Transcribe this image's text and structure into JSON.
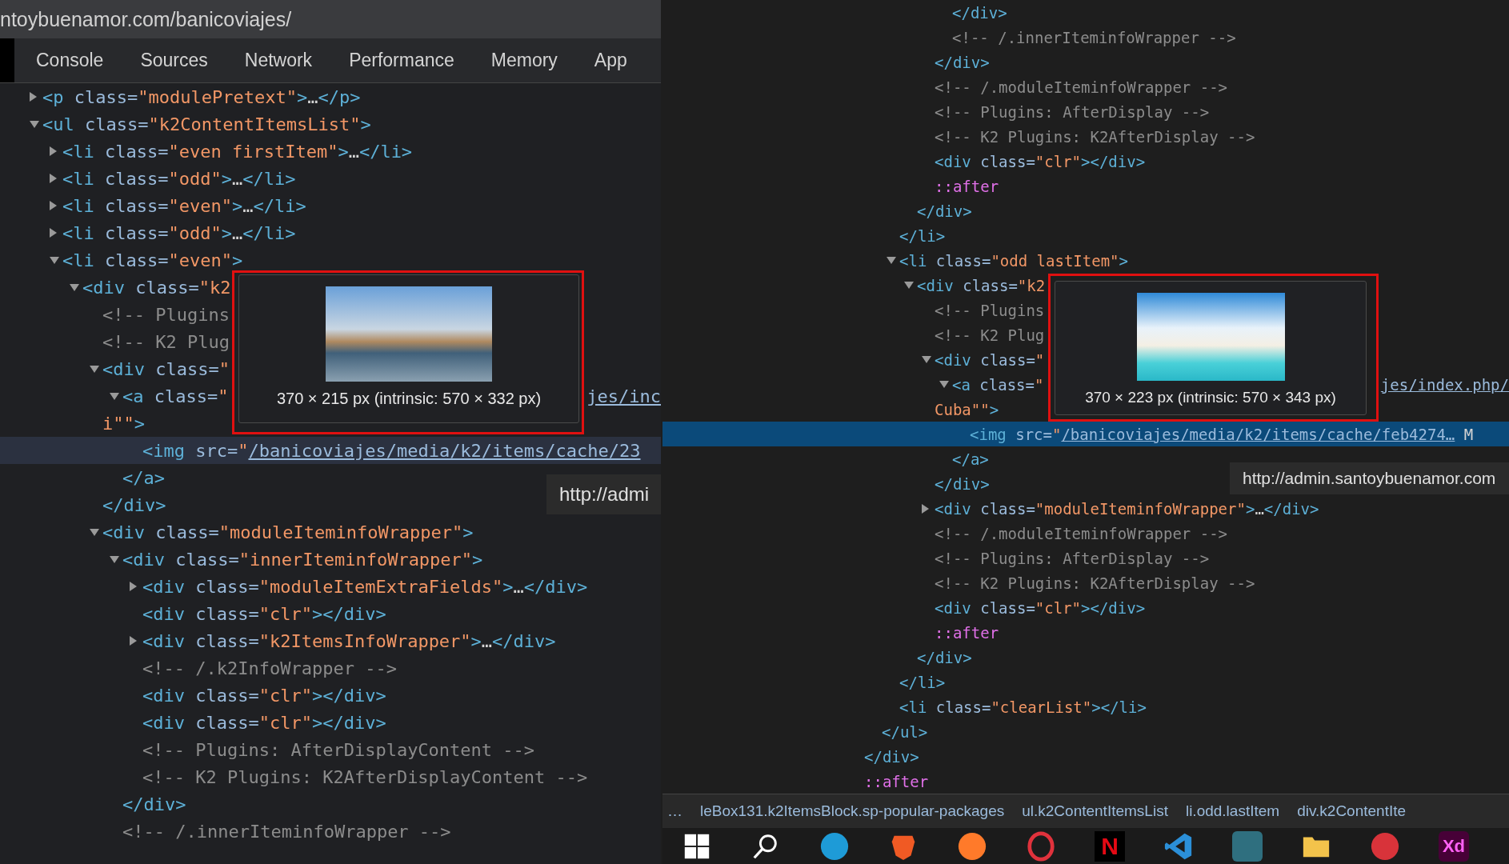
{
  "panels": [
    {
      "focused": false,
      "url": "ntoybuenamor.com/banicoviajes/",
      "tabs": [
        {
          "label": "Console",
          "selected": false
        },
        {
          "label": "Sources",
          "selected": false
        },
        {
          "label": "Network",
          "selected": false
        },
        {
          "label": "Performance",
          "selected": false
        },
        {
          "label": "Memory",
          "selected": false
        },
        {
          "label": "App",
          "selected": false
        }
      ],
      "lines": [
        {
          "code": [
            {
              "kind": "tag",
              "text": "<p"
            },
            {
              "kind": "attr",
              "text": " class="
            },
            {
              "kind": "value",
              "text": "\"modulePretext\""
            },
            {
              "kind": "tag",
              "text": ">"
            },
            {
              "kind": "text",
              "text": "…"
            },
            {
              "kind": "tag",
              "text": "</p>"
            }
          ],
          "expanded": false,
          "selected": false
        },
        {
          "code": [
            {
              "kind": "tag",
              "text": "<ul"
            },
            {
              "kind": "attr",
              "text": " class="
            },
            {
              "kind": "value",
              "text": "\"k2ContentItemsList\""
            },
            {
              "kind": "tag",
              "text": ">"
            }
          ],
          "expanded": true,
          "selected": false,
          "children": [
            {
              "code": [
                {
                  "kind": "tag",
                  "text": "<li"
                },
                {
                  "kind": "attr",
                  "text": " class="
                },
                {
                  "kind": "value",
                  "text": "\"even firstItem\""
                },
                {
                  "kind": "tag",
                  "text": ">"
                },
                {
                  "kind": "text",
                  "text": "…"
                },
                {
                  "kind": "tag",
                  "text": "</li>"
                }
              ],
              "expanded": false,
              "selected": false
            },
            {
              "code": [
                {
                  "kind": "tag",
                  "text": "<li"
                },
                {
                  "kind": "attr",
                  "text": " class="
                },
                {
                  "kind": "value",
                  "text": "\"odd\""
                },
                {
                  "kind": "tag",
                  "text": ">"
                },
                {
                  "kind": "text",
                  "text": "…"
                },
                {
                  "kind": "tag",
                  "text": "</li>"
                }
              ],
              "expanded": false,
              "selected": false
            },
            {
              "code": [
                {
                  "kind": "tag",
                  "text": "<li"
                },
                {
                  "kind": "attr",
                  "text": " class="
                },
                {
                  "kind": "value",
                  "text": "\"even\""
                },
                {
                  "kind": "tag",
                  "text": ">"
                },
                {
                  "kind": "text",
                  "text": "…"
                },
                {
                  "kind": "tag",
                  "text": "</li>"
                }
              ],
              "expanded": false,
              "selected": false
            },
            {
              "code": [
                {
                  "kind": "tag",
                  "text": "<li"
                },
                {
                  "kind": "attr",
                  "text": " class="
                },
                {
                  "kind": "value",
                  "text": "\"odd\""
                },
                {
                  "kind": "tag",
                  "text": ">"
                },
                {
                  "kind": "text",
                  "text": "…"
                },
                {
                  "kind": "tag",
                  "text": "</li>"
                }
              ],
              "expanded": false,
              "selected": false
            },
            {
              "code": [
                {
                  "kind": "tag",
                  "text": "<li"
                },
                {
                  "kind": "attr",
                  "text": " class="
                },
                {
                  "kind": "value",
                  "text": "\"even\""
                },
                {
                  "kind": "tag",
                  "text": ">"
                }
              ],
              "expanded": true,
              "selected": false,
              "children": [
                {
                  "code": [
                    {
                      "kind": "tag",
                      "text": "<div"
                    },
                    {
                      "kind": "attr",
                      "text": " class="
                    },
                    {
                      "kind": "value",
                      "text": "\"k2"
                    }
                  ],
                  "expanded": true,
                  "selected": false,
                  "children": [
                    {
                      "code": [
                        {
                          "kind": "comment",
                          "text": "<!-- Plugins"
                        }
                      ],
                      "selected": false
                    },
                    {
                      "code": [
                        {
                          "kind": "comment",
                          "text": "<!-- K2 Plug"
                        }
                      ],
                      "selected": false
                    },
                    {
                      "code": [
                        {
                          "kind": "tag",
                          "text": "<div"
                        },
                        {
                          "kind": "attr",
                          "text": " class="
                        },
                        {
                          "kind": "value",
                          "text": "\""
                        }
                      ],
                      "expanded": true,
                      "selected": false,
                      "children": [
                        {
                          "code": [
                            {
                              "kind": "tag",
                              "text": "<a"
                            },
                            {
                              "kind": "attr",
                              "text": " class="
                            },
                            {
                              "kind": "value",
                              "text": "\""
                            }
                          ],
                          "tail": [
                            {
                              "kind": "link",
                              "text": "jes/inc"
                            }
                          ],
                          "wrap": [
                            {
                              "kind": "value",
                              "text": "i\"\""
                            },
                            {
                              "kind": "tag",
                              "text": ">"
                            }
                          ],
                          "expanded": true,
                          "selected": false,
                          "children": [
                            {
                              "code": [
                                {
                                  "kind": "tag",
                                  "text": "<img"
                                },
                                {
                                  "kind": "attr",
                                  "text": " src="
                                },
                                {
                                  "kind": "value",
                                  "text": "\""
                                },
                                {
                                  "kind": "link",
                                  "text": "/banicoviajes/media/k2/items/cache/23"
                                }
                              ],
                              "selected": true
                            }
                          ]
                        },
                        {
                          "code": [
                            {
                              "kind": "tag",
                              "text": "</a>"
                            }
                          ],
                          "selected": false
                        }
                      ]
                    },
                    {
                      "code": [
                        {
                          "kind": "tag",
                          "text": "</div>"
                        }
                      ],
                      "selected": false
                    },
                    {
                      "code": [
                        {
                          "kind": "tag",
                          "text": "<div"
                        },
                        {
                          "kind": "attr",
                          "text": " class="
                        },
                        {
                          "kind": "value",
                          "text": "\"moduleIteminfoWrapper\""
                        },
                        {
                          "kind": "tag",
                          "text": ">"
                        }
                      ],
                      "expanded": true,
                      "selected": false,
                      "children": [
                        {
                          "code": [
                            {
                              "kind": "tag",
                              "text": "<div"
                            },
                            {
                              "kind": "attr",
                              "text": " class="
                            },
                            {
                              "kind": "value",
                              "text": "\"innerIteminfoWrapper\""
                            },
                            {
                              "kind": "tag",
                              "text": ">"
                            }
                          ],
                          "expanded": true,
                          "selected": false,
                          "children": [
                            {
                              "code": [
                                {
                                  "kind": "tag",
                                  "text": "<div"
                                },
                                {
                                  "kind": "attr",
                                  "text": " class="
                                },
                                {
                                  "kind": "value",
                                  "text": "\"moduleItemExtraFields\""
                                },
                                {
                                  "kind": "tag",
                                  "text": ">"
                                },
                                {
                                  "kind": "text",
                                  "text": "…"
                                },
                                {
                                  "kind": "tag",
                                  "text": "</div>"
                                }
                              ],
                              "expanded": false,
                              "selected": false
                            },
                            {
                              "code": [
                                {
                                  "kind": "tag",
                                  "text": "<div"
                                },
                                {
                                  "kind": "attr",
                                  "text": " class="
                                },
                                {
                                  "kind": "value",
                                  "text": "\"clr\""
                                },
                                {
                                  "kind": "tag",
                                  "text": "></div>"
                                }
                              ],
                              "selected": false
                            },
                            {
                              "code": [
                                {
                                  "kind": "tag",
                                  "text": "<div"
                                },
                                {
                                  "kind": "attr",
                                  "text": " class="
                                },
                                {
                                  "kind": "value",
                                  "text": "\"k2ItemsInfoWrapper\""
                                },
                                {
                                  "kind": "tag",
                                  "text": ">"
                                },
                                {
                                  "kind": "text",
                                  "text": "…"
                                },
                                {
                                  "kind": "tag",
                                  "text": "</div>"
                                }
                              ],
                              "expanded": false,
                              "selected": false
                            },
                            {
                              "code": [
                                {
                                  "kind": "comment",
                                  "text": "<!-- /.k2InfoWrapper -->"
                                }
                              ],
                              "selected": false
                            },
                            {
                              "code": [
                                {
                                  "kind": "tag",
                                  "text": "<div"
                                },
                                {
                                  "kind": "attr",
                                  "text": " class="
                                },
                                {
                                  "kind": "value",
                                  "text": "\"clr\""
                                },
                                {
                                  "kind": "tag",
                                  "text": "></div>"
                                }
                              ],
                              "selected": false
                            },
                            {
                              "code": [
                                {
                                  "kind": "tag",
                                  "text": "<div"
                                },
                                {
                                  "kind": "attr",
                                  "text": " class="
                                },
                                {
                                  "kind": "value",
                                  "text": "\"clr\""
                                },
                                {
                                  "kind": "tag",
                                  "text": "></div>"
                                }
                              ],
                              "selected": false
                            },
                            {
                              "code": [
                                {
                                  "kind": "comment",
                                  "text": "<!-- Plugins: AfterDisplayContent -->"
                                }
                              ],
                              "selected": false
                            },
                            {
                              "code": [
                                {
                                  "kind": "comment",
                                  "text": "<!-- K2 Plugins: K2AfterDisplayContent -->"
                                }
                              ],
                              "selected": false
                            }
                          ]
                        },
                        {
                          "code": [
                            {
                              "kind": "tag",
                              "text": "</div>"
                            }
                          ],
                          "selected": false
                        },
                        {
                          "code": [
                            {
                              "kind": "comment",
                              "text": "<!-- /.innerIteminfoWrapper -->"
                            }
                          ],
                          "selected": false
                        }
                      ]
                    }
                  ]
                }
              ]
            }
          ]
        }
      ],
      "image_tooltip": "370 × 215 px (intrinsic: 570 × 332 px)",
      "link_tooltip": "http://admi"
    },
    {
      "focused": true,
      "lines": [
        {
          "children": [
            {
              "children": [
                {
                  "children": [
                    {
                      "children": [
                        {
                          "children": [
                            {
                              "code": [
                                {
                                  "kind": "tag",
                                  "text": "</div>"
                                }
                              ],
                              "selected": false
                            },
                            {
                              "code": [
                                {
                                  "kind": "comment",
                                  "text": "<!-- /.innerIteminfoWrapper -->"
                                }
                              ],
                              "selected": false
                            }
                          ]
                        },
                        {
                          "code": [
                            {
                              "kind": "tag",
                              "text": "</div>"
                            }
                          ],
                          "selected": false
                        },
                        {
                          "code": [
                            {
                              "kind": "comment",
                              "text": "<!-- /.moduleIteminfoWrapper -->"
                            }
                          ],
                          "selected": false
                        },
                        {
                          "code": [
                            {
                              "kind": "comment",
                              "text": "<!-- Plugins: AfterDisplay -->"
                            }
                          ],
                          "selected": false
                        },
                        {
                          "code": [
                            {
                              "kind": "comment",
                              "text": "<!-- K2 Plugins: K2AfterDisplay -->"
                            }
                          ],
                          "selected": false
                        },
                        {
                          "code": [
                            {
                              "kind": "tag",
                              "text": "<div"
                            },
                            {
                              "kind": "attr",
                              "text": " class="
                            },
                            {
                              "kind": "value",
                              "text": "\"clr\""
                            },
                            {
                              "kind": "tag",
                              "text": "></div>"
                            }
                          ],
                          "selected": false
                        },
                        {
                          "code": [
                            {
                              "kind": "pseudo",
                              "text": "::after"
                            }
                          ],
                          "selected": false
                        }
                      ]
                    },
                    {
                      "code": [
                        {
                          "kind": "tag",
                          "text": "</div>"
                        }
                      ],
                      "selected": false
                    }
                  ]
                },
                {
                  "code": [
                    {
                      "kind": "tag",
                      "text": "</li>"
                    }
                  ],
                  "selected": false
                },
                {
                  "code": [
                    {
                      "kind": "tag",
                      "text": "<li"
                    },
                    {
                      "kind": "attr",
                      "text": " class="
                    },
                    {
                      "kind": "value",
                      "text": "\"odd lastItem\""
                    },
                    {
                      "kind": "tag",
                      "text": ">"
                    }
                  ],
                  "expanded": true,
                  "selected": false,
                  "children": [
                    {
                      "code": [
                        {
                          "kind": "tag",
                          "text": "<div"
                        },
                        {
                          "kind": "attr",
                          "text": " class="
                        },
                        {
                          "kind": "value",
                          "text": "\"k2"
                        }
                      ],
                      "expanded": true,
                      "selected": false,
                      "children": [
                        {
                          "code": [
                            {
                              "kind": "comment",
                              "text": "<!-- Plugins"
                            }
                          ],
                          "selected": false
                        },
                        {
                          "code": [
                            {
                              "kind": "comment",
                              "text": "<!-- K2 Plug"
                            }
                          ],
                          "selected": false
                        },
                        {
                          "code": [
                            {
                              "kind": "tag",
                              "text": "<div"
                            },
                            {
                              "kind": "attr",
                              "text": " class="
                            },
                            {
                              "kind": "value",
                              "text": "\""
                            }
                          ],
                          "expanded": true,
                          "selected": false,
                          "children": [
                            {
                              "code": [
                                {
                                  "kind": "tag",
                                  "text": "<a"
                                },
                                {
                                  "kind": "attr",
                                  "text": " class="
                                },
                                {
                                  "kind": "value",
                                  "text": "\""
                                }
                              ],
                              "tail": [
                                {
                                  "kind": "link",
                                  "text": "jes/index.php/"
                                }
                              ],
                              "wrap": [
                                {
                                  "kind": "value",
                                  "text": "Cuba\"\""
                                },
                                {
                                  "kind": "tag",
                                  "text": ">"
                                }
                              ],
                              "expanded": true,
                              "selected": false,
                              "children": [
                                {
                                  "code": [
                                    {
                                      "kind": "tag",
                                      "text": "<img"
                                    },
                                    {
                                      "kind": "attr",
                                      "text": " src="
                                    },
                                    {
                                      "kind": "value",
                                      "text": "\""
                                    },
                                    {
                                      "kind": "link",
                                      "text": "/banicoviajes/media/k2/items/cache/feb4274…"
                                    },
                                    {
                                      "kind": "text",
                                      "text": " M"
                                    }
                                  ],
                                  "selected": true
                                }
                              ]
                            },
                            {
                              "code": [
                                {
                                  "kind": "tag",
                                  "text": "</a>"
                                }
                              ],
                              "selected": false
                            }
                          ]
                        },
                        {
                          "code": [
                            {
                              "kind": "tag",
                              "text": "</div>"
                            }
                          ],
                          "selected": false
                        },
                        {
                          "code": [
                            {
                              "kind": "tag",
                              "text": "<div"
                            },
                            {
                              "kind": "attr",
                              "text": " class="
                            },
                            {
                              "kind": "value",
                              "text": "\"moduleIteminfoWrapper\""
                            },
                            {
                              "kind": "tag",
                              "text": ">"
                            },
                            {
                              "kind": "text",
                              "text": "…"
                            },
                            {
                              "kind": "tag",
                              "text": "</div>"
                            }
                          ],
                          "expanded": false,
                          "selected": false
                        },
                        {
                          "code": [
                            {
                              "kind": "comment",
                              "text": "<!-- /.moduleIteminfoWrapper -->"
                            }
                          ],
                          "selected": false
                        },
                        {
                          "code": [
                            {
                              "kind": "comment",
                              "text": "<!-- Plugins: AfterDisplay -->"
                            }
                          ],
                          "selected": false
                        },
                        {
                          "code": [
                            {
                              "kind": "comment",
                              "text": "<!-- K2 Plugins: K2AfterDisplay -->"
                            }
                          ],
                          "selected": false
                        },
                        {
                          "code": [
                            {
                              "kind": "tag",
                              "text": "<div"
                            },
                            {
                              "kind": "attr",
                              "text": " class="
                            },
                            {
                              "kind": "value",
                              "text": "\"clr\""
                            },
                            {
                              "kind": "tag",
                              "text": "></div>"
                            }
                          ],
                          "selected": false
                        },
                        {
                          "code": [
                            {
                              "kind": "pseudo",
                              "text": "::after"
                            }
                          ],
                          "selected": false
                        }
                      ]
                    },
                    {
                      "code": [
                        {
                          "kind": "tag",
                          "text": "</div>"
                        }
                      ],
                      "selected": false
                    }
                  ]
                },
                {
                  "code": [
                    {
                      "kind": "tag",
                      "text": "</li>"
                    }
                  ],
                  "selected": false
                },
                {
                  "code": [
                    {
                      "kind": "tag",
                      "text": "<li"
                    },
                    {
                      "kind": "attr",
                      "text": " class="
                    },
                    {
                      "kind": "value",
                      "text": "\"clearList\""
                    },
                    {
                      "kind": "tag",
                      "text": "></li>"
                    }
                  ],
                  "selected": false
                }
              ]
            },
            {
              "code": [
                {
                  "kind": "tag",
                  "text": "</ul>"
                }
              ],
              "selected": false
            }
          ]
        },
        {
          "code": [
            {
              "kind": "tag",
              "text": "</div>"
            }
          ],
          "selected": false
        },
        {
          "code": [
            {
              "kind": "pseudo",
              "text": "::after"
            }
          ],
          "selected": false
        }
      ],
      "image_tooltip": "370 × 223 px (intrinsic: 570 × 343 px)",
      "link_tooltip": "http://admin.santoybuenamor.com",
      "breadcrumbs": [
        "…",
        "leBox131.k2ItemsBlock.sp-popular-packages",
        "ul.k2ContentItemsList",
        "li.odd.lastItem",
        "div.k2ContentIte"
      ],
      "taskbar": [
        {
          "kind": "start"
        },
        {
          "kind": "search"
        },
        {
          "kind": "circle",
          "color": "#1e9bd7"
        },
        {
          "kind": "shield",
          "color": "#f05a24"
        },
        {
          "kind": "circle",
          "color": "#ff7a2a"
        },
        {
          "kind": "ring",
          "color": "#e0323c"
        },
        {
          "kind": "letter",
          "color": "#e50914",
          "label": "N"
        },
        {
          "kind": "chevron",
          "color": "#2b8fd8"
        },
        {
          "kind": "tile",
          "color": "#2f6f7f"
        },
        {
          "kind": "folder",
          "color": "#f3c34b"
        },
        {
          "kind": "circle",
          "color": "#d8333a"
        },
        {
          "kind": "tile",
          "color": "#470137",
          "label": "Xd"
        }
      ]
    }
  ]
}
